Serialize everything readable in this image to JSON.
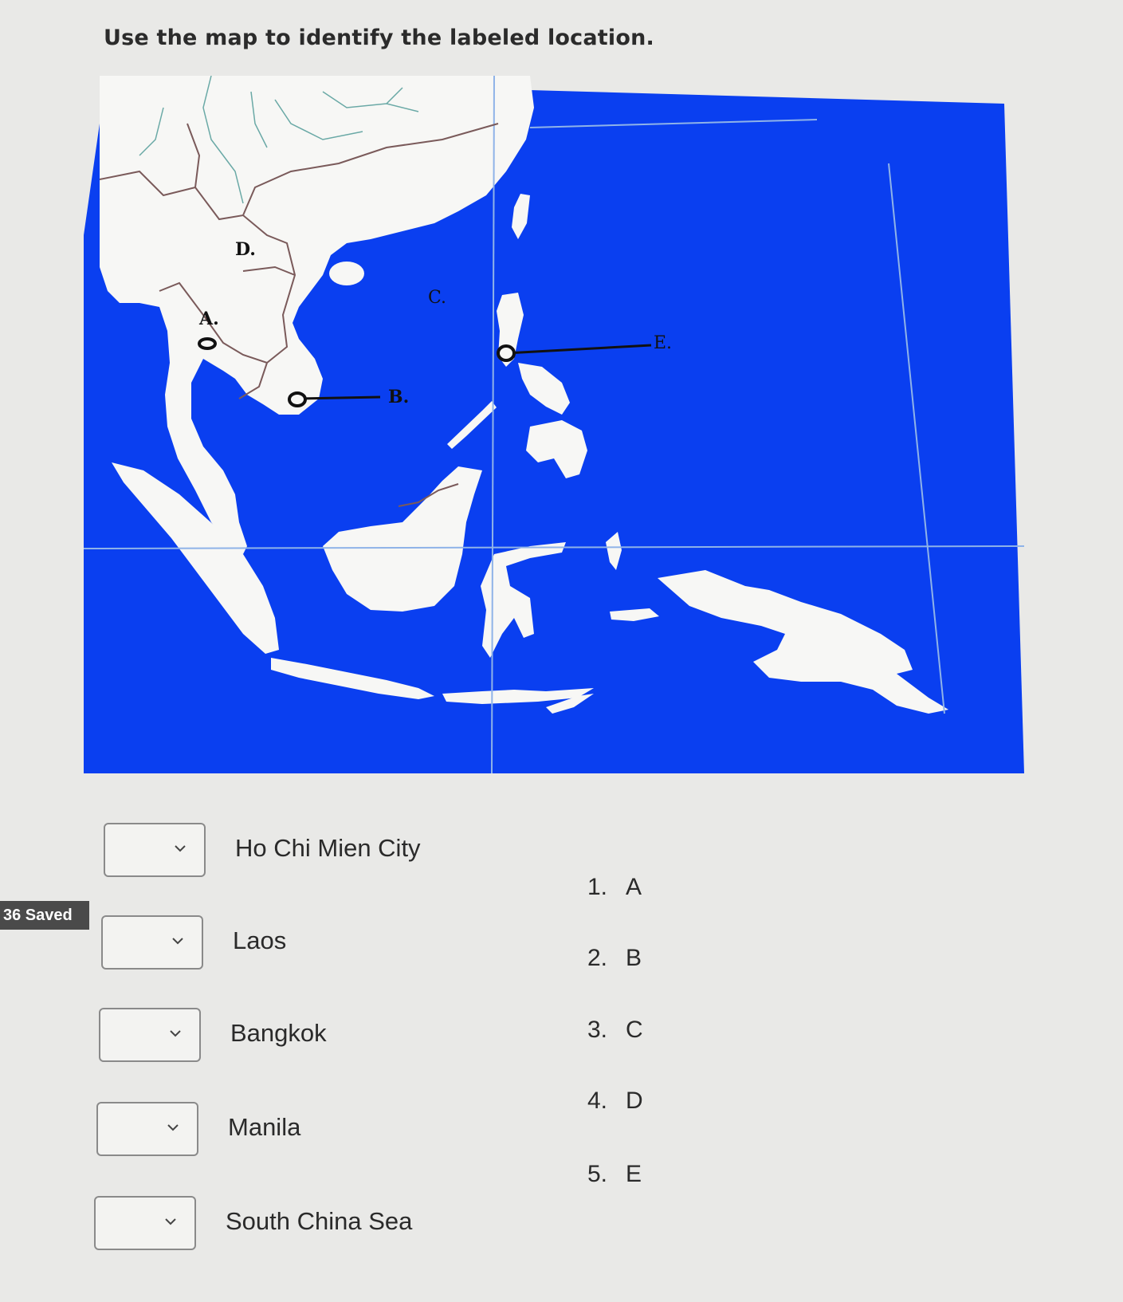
{
  "question": {
    "prompt": "Use the map to identify the labeled location."
  },
  "map": {
    "markers": [
      "A.",
      "B.",
      "C.",
      "D.",
      "E."
    ],
    "colors": {
      "ocean": "#0a3ff0",
      "land": "#f7f7f5",
      "border": "#7a5a5a",
      "river": "#6aa9a6",
      "grid": "#8fb3e8"
    }
  },
  "status": {
    "saved_label": "36 Saved"
  },
  "matches": [
    {
      "label": "Ho Chi Mien City",
      "selected": ""
    },
    {
      "label": "Laos",
      "selected": ""
    },
    {
      "label": "Bangkok",
      "selected": ""
    },
    {
      "label": "Manila",
      "selected": ""
    },
    {
      "label": "South China Sea",
      "selected": ""
    }
  ],
  "answers": [
    {
      "num": "1.",
      "letter": "A"
    },
    {
      "num": "2.",
      "letter": "B"
    },
    {
      "num": "3.",
      "letter": "C"
    },
    {
      "num": "4.",
      "letter": "D"
    },
    {
      "num": "5.",
      "letter": "E"
    }
  ]
}
